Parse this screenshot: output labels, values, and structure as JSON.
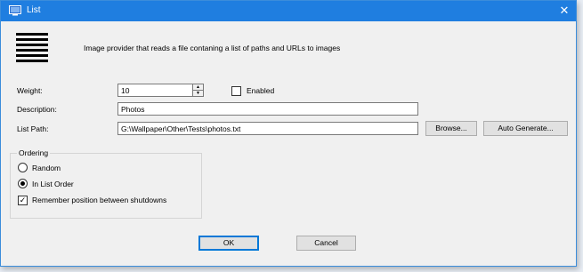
{
  "window": {
    "title": "List",
    "close_glyph": "✕"
  },
  "provider": {
    "icon": "list-lines-icon",
    "description": "Image provider that reads a file contaning a list of paths and URLs to images"
  },
  "form": {
    "weight_label": "Weight:",
    "weight_value": "10",
    "enabled_label": "Enabled",
    "enabled_checked": false,
    "description_label": "Description:",
    "description_value": "Photos",
    "list_path_label": "List Path:",
    "list_path_value": "G:\\Wallpaper\\Other\\Tests\\photos.txt",
    "browse_label": "Browse...",
    "auto_generate_label": "Auto Generate..."
  },
  "ordering": {
    "title": "Ordering",
    "random_label": "Random",
    "in_list_order_label": "In List Order",
    "selected": "In List Order",
    "remember_label": "Remember position between shutdowns",
    "remember_checked": true
  },
  "footer": {
    "ok_label": "OK",
    "cancel_label": "Cancel"
  },
  "colors": {
    "title_bar": "#1f7ee0",
    "default_button_border": "#0078d7"
  }
}
